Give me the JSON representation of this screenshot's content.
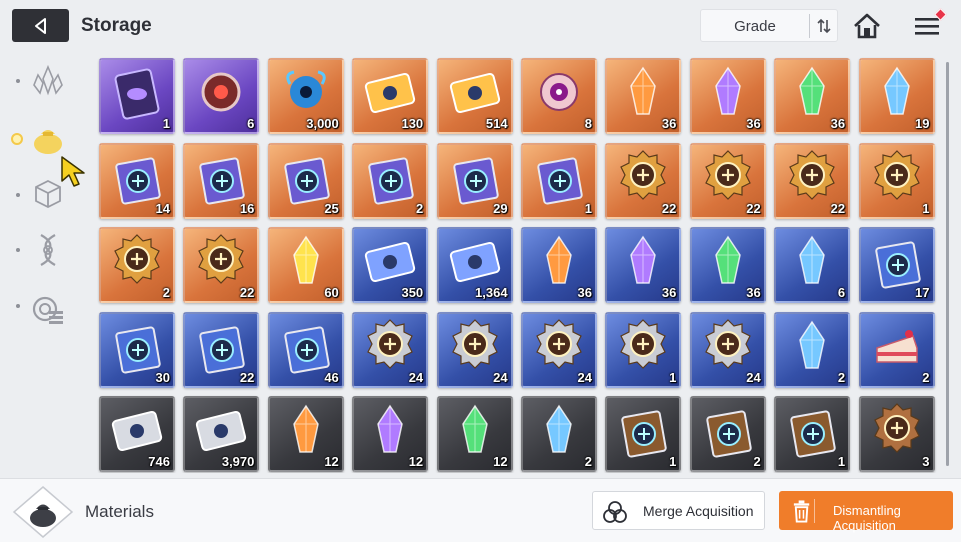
{
  "header": {
    "back_icon": "back-arrow-icon",
    "title": "Storage",
    "sort_label": "Grade",
    "sort_toggle_icon": "sort-order-icon",
    "home_icon": "home-icon",
    "menu_icon": "hamburger-menu-icon"
  },
  "sidebar": {
    "tabs": [
      {
        "icon": "crystal-cluster-icon",
        "active": false
      },
      {
        "icon": "material-bag-icon",
        "active": true
      },
      {
        "icon": "cube-icon",
        "active": false
      },
      {
        "icon": "dna-helix-icon",
        "active": false
      },
      {
        "icon": "gear-module-icon",
        "active": false
      }
    ]
  },
  "items": [
    {
      "icon": "card-pack-icon",
      "rarity": "purple",
      "qty": "1"
    },
    {
      "icon": "red-core-icon",
      "rarity": "purple",
      "qty": "6"
    },
    {
      "icon": "blue-flame-orb-icon",
      "rarity": "orange",
      "qty": "3,000"
    },
    {
      "icon": "gold-ticket-icon",
      "rarity": "orange",
      "qty": "130"
    },
    {
      "icon": "compass-ticket-icon",
      "rarity": "orange",
      "qty": "514"
    },
    {
      "icon": "purple-eye-orb-icon",
      "rarity": "orange",
      "qty": "8"
    },
    {
      "icon": "orange-crystal-icon",
      "rarity": "orange",
      "qty": "36"
    },
    {
      "icon": "purple-crystal-icon",
      "rarity": "orange",
      "qty": "36"
    },
    {
      "icon": "green-crystal-icon",
      "rarity": "orange",
      "qty": "36"
    },
    {
      "icon": "blue-crystal-icon",
      "rarity": "orange",
      "qty": "19"
    },
    {
      "icon": "sword-book-icon",
      "rarity": "orange",
      "qty": "14"
    },
    {
      "icon": "shield-book-icon",
      "rarity": "orange",
      "qty": "16"
    },
    {
      "icon": "eye-book-icon",
      "rarity": "orange",
      "qty": "25"
    },
    {
      "icon": "wing-book-icon",
      "rarity": "orange",
      "qty": "2"
    },
    {
      "icon": "bolt-book-icon",
      "rarity": "orange",
      "qty": "29"
    },
    {
      "icon": "target-book-icon",
      "rarity": "orange",
      "qty": "1"
    },
    {
      "icon": "sword-medal-icon",
      "rarity": "orange",
      "qty": "22"
    },
    {
      "icon": "shield-medal-icon",
      "rarity": "orange",
      "qty": "22"
    },
    {
      "icon": "eye-medal-icon",
      "rarity": "orange",
      "qty": "22"
    },
    {
      "icon": "wing-medal-icon",
      "rarity": "orange",
      "qty": "1"
    },
    {
      "icon": "compass-medal-icon",
      "rarity": "orange",
      "qty": "2"
    },
    {
      "icon": "target-medal-icon",
      "rarity": "orange",
      "qty": "22"
    },
    {
      "icon": "yellow-shards-icon",
      "rarity": "orange",
      "qty": "60"
    },
    {
      "icon": "blue-ticket-icon",
      "rarity": "blue",
      "qty": "350"
    },
    {
      "icon": "blue-compass-ticket-icon",
      "rarity": "blue",
      "qty": "1,364"
    },
    {
      "icon": "orange-crystal-small-icon",
      "rarity": "blue",
      "qty": "36"
    },
    {
      "icon": "purple-crystal-small-icon",
      "rarity": "blue",
      "qty": "36"
    },
    {
      "icon": "green-crystal-small-icon",
      "rarity": "blue",
      "qty": "36"
    },
    {
      "icon": "blue-crystal-small-icon",
      "rarity": "blue",
      "qty": "6"
    },
    {
      "icon": "eye-book-blue-icon",
      "rarity": "blue",
      "qty": "17"
    },
    {
      "icon": "wing-book-blue-icon",
      "rarity": "blue",
      "qty": "30"
    },
    {
      "icon": "bolt-book-blue-icon",
      "rarity": "blue",
      "qty": "22"
    },
    {
      "icon": "target-book-blue-icon",
      "rarity": "blue",
      "qty": "46"
    },
    {
      "icon": "sword-medal-silver-icon",
      "rarity": "blue",
      "qty": "24"
    },
    {
      "icon": "shield-medal-silver-icon",
      "rarity": "blue",
      "qty": "24"
    },
    {
      "icon": "eye-medal-silver-icon",
      "rarity": "blue",
      "qty": "24"
    },
    {
      "icon": "compass-medal-silver-icon",
      "rarity": "blue",
      "qty": "1"
    },
    {
      "icon": "target-medal-silver-icon",
      "rarity": "blue",
      "qty": "24"
    },
    {
      "icon": "ice-crystal-icon",
      "rarity": "blue",
      "qty": "2"
    },
    {
      "icon": "cake-slice-icon",
      "rarity": "blue",
      "qty": "2"
    },
    {
      "icon": "silver-ticket-icon",
      "rarity": "dark",
      "qty": "746"
    },
    {
      "icon": "silver-compass-ticket-icon",
      "rarity": "dark",
      "qty": "3,970"
    },
    {
      "icon": "orange-shard-icon",
      "rarity": "dark",
      "qty": "12"
    },
    {
      "icon": "purple-shard-icon",
      "rarity": "dark",
      "qty": "12"
    },
    {
      "icon": "green-shard-icon",
      "rarity": "dark",
      "qty": "12"
    },
    {
      "icon": "blue-shard-icon",
      "rarity": "dark",
      "qty": "2"
    },
    {
      "icon": "eye-book-brown-icon",
      "rarity": "dark",
      "qty": "1"
    },
    {
      "icon": "bolt-book-brown-icon",
      "rarity": "dark",
      "qty": "2"
    },
    {
      "icon": "target-book-brown-icon",
      "rarity": "dark",
      "qty": "1"
    },
    {
      "icon": "sword-medal-bronze-icon",
      "rarity": "dark",
      "qty": "3"
    }
  ],
  "footer": {
    "category_icon": "material-bag-icon",
    "category_title": "Materials",
    "merge_label": "Merge Acquisition",
    "merge_icon": "merge-circles-icon",
    "dismantle_label": "Dismantling Acquisition",
    "dismantle_icon": "trash-icon"
  },
  "colors": {
    "accent_orange": "#f07d2a",
    "rarity_orange": "#d9743c",
    "rarity_purple": "#6b47c2",
    "rarity_blue": "#3450a8",
    "rarity_dark": "#38393e",
    "notification_red": "#e8344a"
  }
}
